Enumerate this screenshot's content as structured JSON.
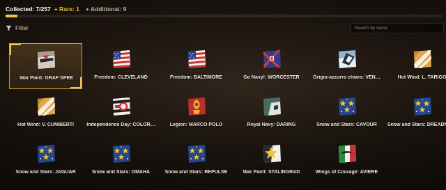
{
  "header": {
    "collected_text": "Collected: 7/257",
    "rare_text": "+ Rare: 1",
    "additional_text": "+ Additional: 9",
    "progress_fraction": 0.027
  },
  "toolbar": {
    "filter_label": "Filter",
    "search_placeholder": "Search by name"
  },
  "colors": {
    "accent_gold": "#f1c245",
    "rare": "#f0b93a"
  },
  "items": [
    {
      "label": "War Paint: GRAF SPEE",
      "icon": "graf-spee-camo-icon",
      "selected": true
    },
    {
      "label": "Freedom: CLEVELAND",
      "icon": "us-flag-icon"
    },
    {
      "label": "Freedom: BALTIMORE",
      "icon": "us-flag-icon"
    },
    {
      "label": "Go Navy!: WORCESTER",
      "icon": "go-navy-flag-icon"
    },
    {
      "label": "Grigio-azzurro chiaro: VEN…",
      "icon": "grigio-azzurro-icon"
    },
    {
      "label": "Hot Wind: L. TARIGO",
      "icon": "hot-wind-stripe-icon"
    },
    {
      "label": "Hot Wind: V. CUNIBERTI",
      "icon": "hot-wind-stripe-icon"
    },
    {
      "label": "Independence Day: COLOR…",
      "icon": "independence-day-icon"
    },
    {
      "label": "Legion: MARCO POLO",
      "icon": "legion-emblem-icon"
    },
    {
      "label": "Royal Navy: DARING",
      "icon": "royal-navy-icon"
    },
    {
      "label": "Snow and Stars: CAVOUR",
      "icon": "snow-stars-icon"
    },
    {
      "label": "Snow and Stars: DREADNO…",
      "icon": "snow-stars-icon"
    },
    {
      "label": "Snow and Stars: JAGUAR",
      "icon": "snow-stars-icon"
    },
    {
      "label": "Snow and Stars: OMAHA",
      "icon": "snow-stars-icon"
    },
    {
      "label": "Snow and Stars: REPULSE",
      "icon": "snow-stars-icon"
    },
    {
      "label": "War Paint: STALINGRAD",
      "icon": "stalingrad-star-icon"
    },
    {
      "label": "Wings of Courage: AVIERE",
      "icon": "wings-of-courage-icon"
    }
  ]
}
